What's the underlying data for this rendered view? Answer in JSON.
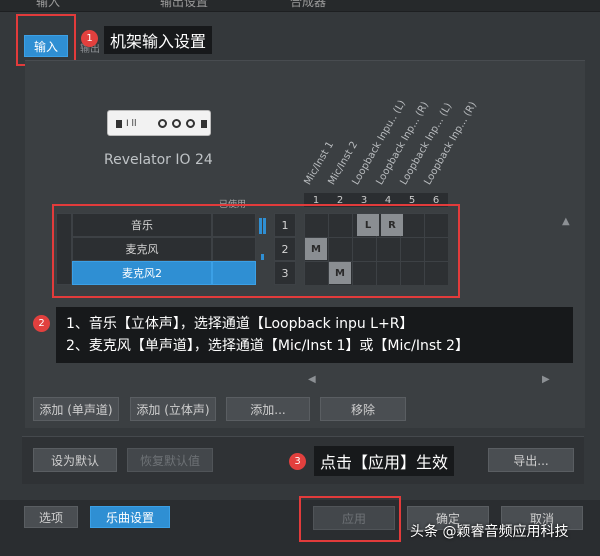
{
  "window": {
    "top_tabs": [
      "输入",
      "输出设置",
      "合成器"
    ]
  },
  "tabs": {
    "input": "输入",
    "output_partial": "输出"
  },
  "device": {
    "model_label": "Revelator IO 24",
    "used_label": "已使用",
    "icon_text": "I ll"
  },
  "channels": {
    "headers": [
      "Mic/Inst 1",
      "Mic/Inst 2",
      "Loopback Inpu.. (L)",
      "Loopback Inp... (R)",
      "Loopback Inp... (L)",
      "Loopback Inp... (R)"
    ],
    "numbers": [
      "1",
      "2",
      "3",
      "4",
      "5",
      "6"
    ]
  },
  "inputs": [
    {
      "name": "音乐",
      "num": "1",
      "marks": [
        "",
        "",
        "L",
        "R",
        "",
        ""
      ],
      "selected": false
    },
    {
      "name": "麦克风",
      "num": "2",
      "marks": [
        "M",
        "",
        "",
        "",
        "",
        ""
      ],
      "selected": false
    },
    {
      "name": "麦克风2",
      "num": "3",
      "marks": [
        "",
        "M",
        "",
        "",
        "",
        ""
      ],
      "selected": true
    }
  ],
  "buttons": {
    "add_mono": "添加 (单声道)",
    "add_stereo": "添加 (立体声)",
    "add": "添加...",
    "remove": "移除",
    "set_default": "设为默认",
    "restore_default": "恢复默认值",
    "export": "导出...",
    "options": "选项",
    "song_settings": "乐曲设置",
    "apply": "应用",
    "ok": "确定",
    "cancel": "取消"
  },
  "annotations": {
    "badge1": "1",
    "callout1": "机架输入设置",
    "badge2": "2",
    "note_line1": "1、音乐【立体声】，选择通道【Loopback inpu L+R】",
    "note_line2": "2、麦克风【单声道】，选择通道【Mic/Inst 1】或【Mic/Inst 2】",
    "badge3": "3",
    "callout3": "点击【应用】生效"
  },
  "watermark": "头条 @颖睿音频应用科技",
  "colors": {
    "accent_blue": "#2f8fd3",
    "annotation_red": "#e23b3b",
    "callout_bg": "#17191b"
  }
}
